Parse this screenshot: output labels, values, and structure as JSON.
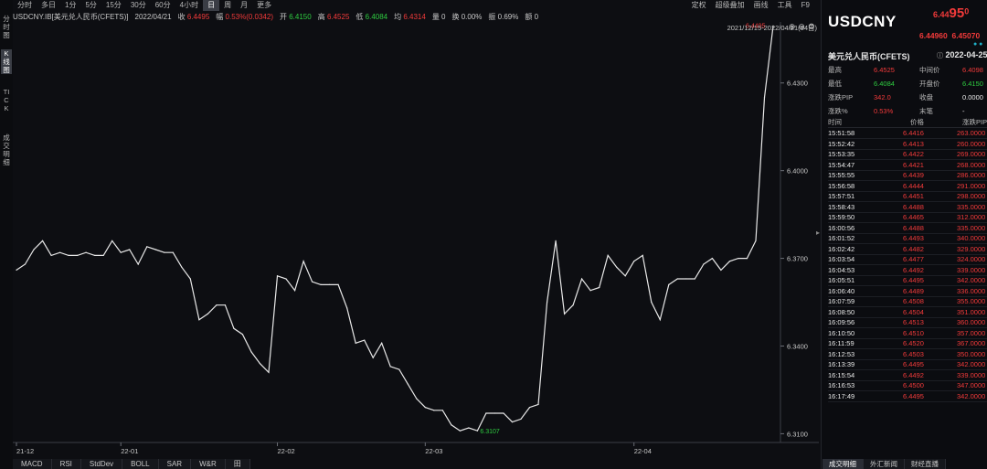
{
  "toolbar": {
    "tabs": [
      "分时",
      "多日",
      "1分",
      "5分",
      "15分",
      "30分",
      "60分",
      "4小时",
      "日",
      "周",
      "月",
      "更多"
    ],
    "active": "日",
    "right": [
      "定权",
      "超级叠加",
      "画线",
      "工具",
      "F9"
    ]
  },
  "infobar": {
    "symbol": "USDCNY.IB[美元兑人民币(CFETS)]",
    "date": "2022/04/21",
    "close_label": "收",
    "close": "6.4495",
    "change_label": "幅",
    "change": "0.53%(0.0342)",
    "open_label": "开",
    "open": "6.4150",
    "high_label": "高",
    "high": "6.4525",
    "low_label": "低",
    "low": "6.4084",
    "settle_label": "均",
    "settle": "6.4314",
    "vol_label": "量",
    "vol": "0",
    "turn_label": "换",
    "turn": "0.00%",
    "amp_label": "振",
    "amp": "0.69%",
    "amt_label": "额",
    "amt": "0"
  },
  "lefttabs": [
    "分时图",
    "K线图",
    "TICK",
    "成交明细"
  ],
  "chart": {
    "range": "2021/12/15-2022/04/21(84日)",
    "icons": [
      "zoom-in-icon",
      "zoom-out-icon",
      "settings-icon"
    ]
  },
  "chart_data": {
    "type": "line",
    "title": "",
    "x_tick_labels": [
      "21-12",
      "22-01",
      "22-02",
      "22-03",
      "22-04"
    ],
    "y_ticks": [
      6.31,
      6.34,
      6.37,
      6.4,
      6.43
    ],
    "y_tick_labels": [
      "6.3100",
      "6.3400",
      "6.3700",
      "6.4000",
      "6.4300"
    ],
    "ylim": [
      6.307,
      6.449
    ],
    "values": [
      6.366,
      6.368,
      6.373,
      6.376,
      6.371,
      6.372,
      6.371,
      6.371,
      6.372,
      6.371,
      6.371,
      6.376,
      6.372,
      6.373,
      6.368,
      6.374,
      6.373,
      6.372,
      6.372,
      6.367,
      6.363,
      6.349,
      6.351,
      6.354,
      6.354,
      6.346,
      6.344,
      6.338,
      6.334,
      6.331,
      6.364,
      6.363,
      6.359,
      6.369,
      6.362,
      6.361,
      6.361,
      6.361,
      6.353,
      6.341,
      6.342,
      6.336,
      6.341,
      6.333,
      6.332,
      6.327,
      6.322,
      6.319,
      6.318,
      6.318,
      6.313,
      6.311,
      6.312,
      6.311,
      6.317,
      6.317,
      6.317,
      6.314,
      6.315,
      6.319,
      6.32,
      6.355,
      6.376,
      6.351,
      6.354,
      6.363,
      6.359,
      6.36,
      6.371,
      6.367,
      6.364,
      6.369,
      6.371,
      6.355,
      6.349,
      6.361,
      6.363,
      6.363,
      6.363,
      6.368,
      6.37,
      6.366,
      6.369,
      6.37,
      6.37,
      6.376,
      6.425,
      6.4495
    ],
    "x_tick_index": [
      0,
      12,
      30,
      47,
      71
    ],
    "annotations": [
      {
        "label": "6.4495",
        "index": 87
      },
      {
        "label": "6.3107",
        "index": 53
      }
    ],
    "grid": false,
    "line_color": "#e8e8e8"
  },
  "bottomtabs": [
    "MACD",
    "RSI",
    "StdDev",
    "BOLL",
    "SAR",
    "W&R",
    "田"
  ],
  "panel": {
    "symbol": "USDCNY",
    "price_small": "6.44",
    "price_big": "95",
    "price_tail": "0",
    "bid": "6.44960",
    "ask": "6.45070",
    "pair_name": "美元兑人民币(CFETS)",
    "pair_date": "2022-04-25",
    "stats": [
      [
        {
          "label": "最高",
          "value": "6.4525",
          "color": "red"
        },
        {
          "label": "中间价",
          "value": "6.4098",
          "color": "red"
        }
      ],
      [
        {
          "label": "最低",
          "value": "6.4084",
          "color": "green"
        },
        {
          "label": "开盘价",
          "value": "6.4150",
          "color": "green"
        }
      ],
      [
        {
          "label": "涨跌PIP",
          "value": "342.0",
          "color": "red"
        },
        {
          "label": "收盘",
          "value": "0.0000",
          "color": "white"
        }
      ],
      [
        {
          "label": "涨跌%",
          "value": "0.53%",
          "color": "red"
        },
        {
          "label": "末笔",
          "value": "-",
          "color": "white"
        }
      ]
    ],
    "tick_headers": [
      "时间",
      "价格",
      "涨跌PIP"
    ],
    "ticks": [
      [
        "15:51:58",
        "6.4416",
        "263.0000"
      ],
      [
        "15:52:42",
        "6.4413",
        "260.0000"
      ],
      [
        "15:53:35",
        "6.4422",
        "269.0000"
      ],
      [
        "15:54:47",
        "6.4421",
        "268.0000"
      ],
      [
        "15:55:55",
        "6.4439",
        "286.0000"
      ],
      [
        "15:56:58",
        "6.4444",
        "291.0000"
      ],
      [
        "15:57:51",
        "6.4451",
        "298.0000"
      ],
      [
        "15:58:43",
        "6.4488",
        "335.0000"
      ],
      [
        "15:59:50",
        "6.4465",
        "312.0000"
      ],
      [
        "16:00:56",
        "6.4488",
        "335.0000"
      ],
      [
        "16:01:52",
        "6.4493",
        "340.0000"
      ],
      [
        "16:02:42",
        "6.4482",
        "329.0000"
      ],
      [
        "16:03:54",
        "6.4477",
        "324.0000"
      ],
      [
        "16:04:53",
        "6.4492",
        "339.0000"
      ],
      [
        "16:05:51",
        "6.4495",
        "342.0000"
      ],
      [
        "16:06:40",
        "6.4489",
        "336.0000"
      ],
      [
        "16:07:59",
        "6.4508",
        "355.0000"
      ],
      [
        "16:08:50",
        "6.4504",
        "351.0000"
      ],
      [
        "16:09:56",
        "6.4513",
        "360.0000"
      ],
      [
        "16:10:50",
        "6.4510",
        "357.0000"
      ],
      [
        "16:11:59",
        "6.4520",
        "367.0000"
      ],
      [
        "16:12:53",
        "6.4503",
        "350.0000"
      ],
      [
        "16:13:39",
        "6.4495",
        "342.0000"
      ],
      [
        "16:15:54",
        "6.4492",
        "339.0000"
      ],
      [
        "16:16:53",
        "6.4500",
        "347.0000"
      ],
      [
        "16:17:49",
        "6.4495",
        "342.0000"
      ]
    ],
    "tabs": [
      "成交明细",
      "外汇新闻",
      "财经直播"
    ],
    "active_tab": "成交明细"
  }
}
